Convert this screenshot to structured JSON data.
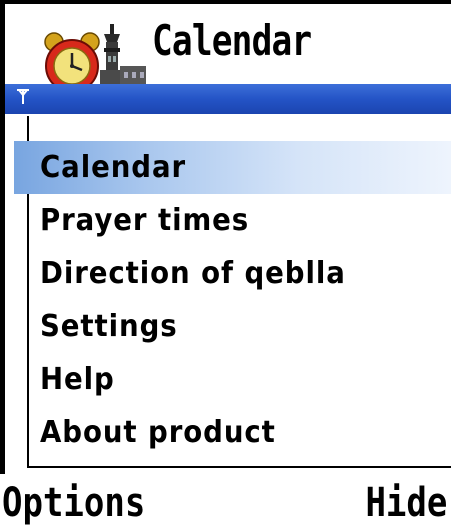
{
  "title_bar": {
    "title": "Calendar",
    "app_icon": "alarm-clock-minaret-icon"
  },
  "status_bar": {
    "signal_icon": "antenna-signal-icon",
    "colors": {
      "bar": "#2454c6"
    }
  },
  "menu": {
    "items": [
      {
        "label": "Calendar",
        "selected": true
      },
      {
        "label": "Prayer times",
        "selected": false
      },
      {
        "label": "Direction of qeblla",
        "selected": false
      },
      {
        "label": "Settings",
        "selected": false
      },
      {
        "label": "Help",
        "selected": false
      },
      {
        "label": "About product",
        "selected": false
      }
    ],
    "colors": {
      "highlight": "#a9c7ee"
    }
  },
  "softkeys": {
    "left": "Options",
    "right": "Hide"
  }
}
